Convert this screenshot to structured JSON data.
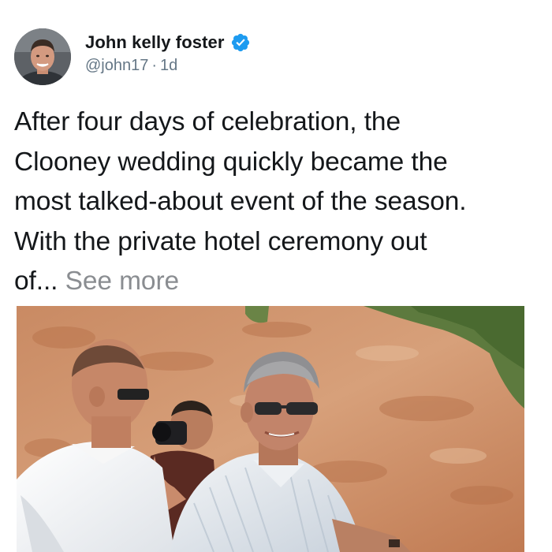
{
  "post": {
    "author_name": "John kelly foster",
    "verified_badge": "verified-badge-icon",
    "handle": "@john17",
    "separator": "·",
    "timestamp": "1d",
    "text_line_1": "After four days of celebration, the",
    "text_line_2": "Clooney wedding quickly became the",
    "text_line_3": "most talked-about event of the season.",
    "text_line_4": "With the private hotel ceremony out",
    "text_line_5": "of...",
    "see_more_label": "See more"
  },
  "colors": {
    "verified_blue": "#1d9bf0",
    "text_primary": "#14171a",
    "text_secondary": "#657786",
    "see_more": "#8a8d91"
  }
}
